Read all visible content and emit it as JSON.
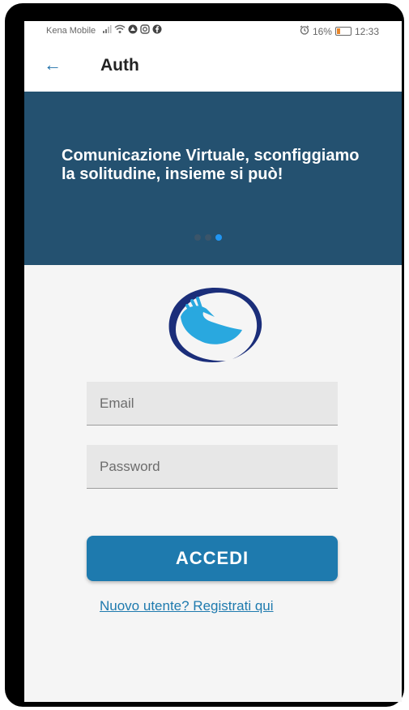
{
  "status_bar": {
    "carrier": "Kena Mobile",
    "battery_percent": "16%",
    "time": "12:33",
    "icons": [
      "signal-icon",
      "wifi-icon",
      "notification-icon",
      "instagram-icon",
      "facebook-icon",
      "alarm-icon",
      "battery-icon"
    ]
  },
  "app_bar": {
    "title": "Auth",
    "back_icon": "arrow-left-icon"
  },
  "hero": {
    "slide_text": "Comunicazione Virtuale, sconfiggiamo la solitudine, insieme si può!",
    "slide_count": 3,
    "active_slide": 3,
    "background_color": "#245170"
  },
  "form": {
    "email_placeholder": "Email",
    "email_value": "",
    "password_placeholder": "Password",
    "password_value": ""
  },
  "login_button": {
    "label": "ACCEDI",
    "color": "#1e7aae"
  },
  "register_link": {
    "label": "Nuovo utente? Registrati qui"
  },
  "logo": {
    "icon": "hand-logo-icon",
    "colors": [
      "#29a8df",
      "#1b2e7a"
    ]
  }
}
